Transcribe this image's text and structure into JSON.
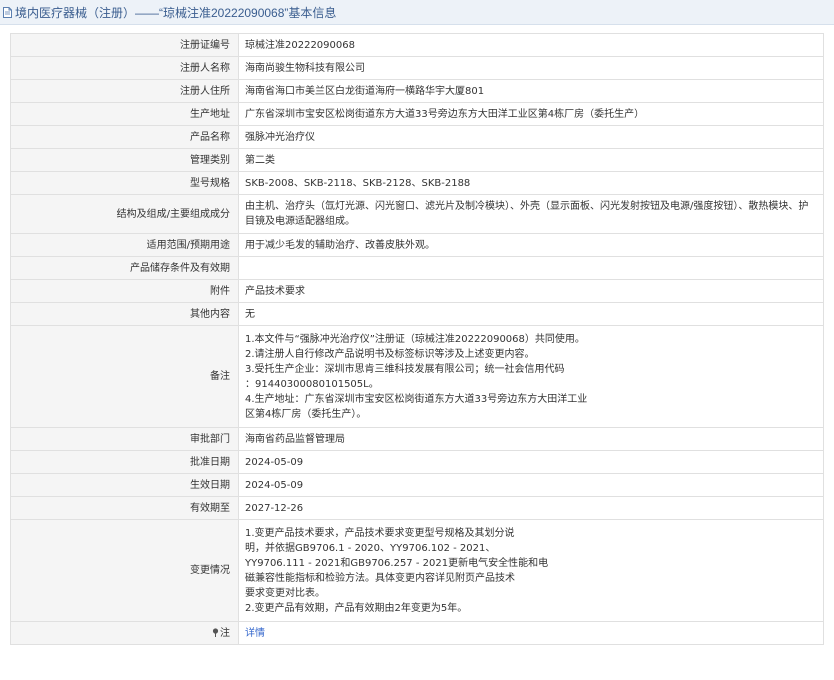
{
  "header": {
    "title": "境内医疗器械（注册）——“琼械注准20222090068”基本信息"
  },
  "colors": {
    "header_bg": "#edf2f8",
    "header_text": "#3a5d8f",
    "label_bg": "#f5f5f5",
    "link": "#3366cc"
  },
  "rows": [
    {
      "label": "注册证编号",
      "value": "琼械注准20222090068"
    },
    {
      "label": "注册人名称",
      "value": "海南尚骏生物科技有限公司"
    },
    {
      "label": "注册人住所",
      "value": "海南省海口市美兰区白龙街道海府一横路华宇大厦801"
    },
    {
      "label": "生产地址",
      "value": "广东省深圳市宝安区松岗街道东方大道33号旁边东方大田洋工业区第4栋厂房（委托生产）"
    },
    {
      "label": "产品名称",
      "value": "强脉冲光治疗仪"
    },
    {
      "label": "管理类别",
      "value": "第二类"
    },
    {
      "label": "型号规格",
      "value": "SKB-2008、SKB-2118、SKB-2128、SKB-2188"
    },
    {
      "label": "结构及组成/主要组成成分",
      "value": "由主机、治疗头（氙灯光源、闪光窗口、滤光片及制冷模块）、外壳（显示面板、闪光发射按钮及电源/强度按钮）、散热模块、护目镜及电源适配器组成。"
    },
    {
      "label": "适用范围/预期用途",
      "value": "用于减少毛发的辅助治疗、改善皮肤外观。"
    },
    {
      "label": "产品储存条件及有效期",
      "value": ""
    },
    {
      "label": "附件",
      "value": "产品技术要求"
    },
    {
      "label": "其他内容",
      "value": "无"
    },
    {
      "label": "备注",
      "value": "1.本文件与“强脉冲光治疗仪”注册证（琼械注准20222090068）共同使用。\n2.请注册人自行修改产品说明书及标签标识等涉及上述变更内容。\n3.受托生产企业：深圳市思肯三维科技发展有限公司；统一社会信用代码\n：91440300080101505L。\n4.生产地址：广东省深圳市宝安区松岗街道东方大道33号旁边东方大田洋工业\n区第4栋厂房（委托生产）。"
    },
    {
      "label": "审批部门",
      "value": "海南省药品监督管理局"
    },
    {
      "label": "批准日期",
      "value": "2024-05-09"
    },
    {
      "label": "生效日期",
      "value": "2024-05-09"
    },
    {
      "label": "有效期至",
      "value": "2027-12-26"
    },
    {
      "label": "变更情况",
      "value": "1.变更产品技术要求，产品技术要求变更型号规格及其划分说\n明，并依据GB9706.1 - 2020、YY9706.102 - 2021、\nYY9706.111 - 2021和GB9706.257 - 2021更新电气安全性能和电\n磁兼容性能指标和检验方法。具体变更内容详见附页产品技术\n要求变更对比表。\n2.变更产品有效期，产品有效期由2年变更为5年。"
    }
  ],
  "footer_row": {
    "label": "注",
    "icon": "pin-icon",
    "link": "详情"
  }
}
